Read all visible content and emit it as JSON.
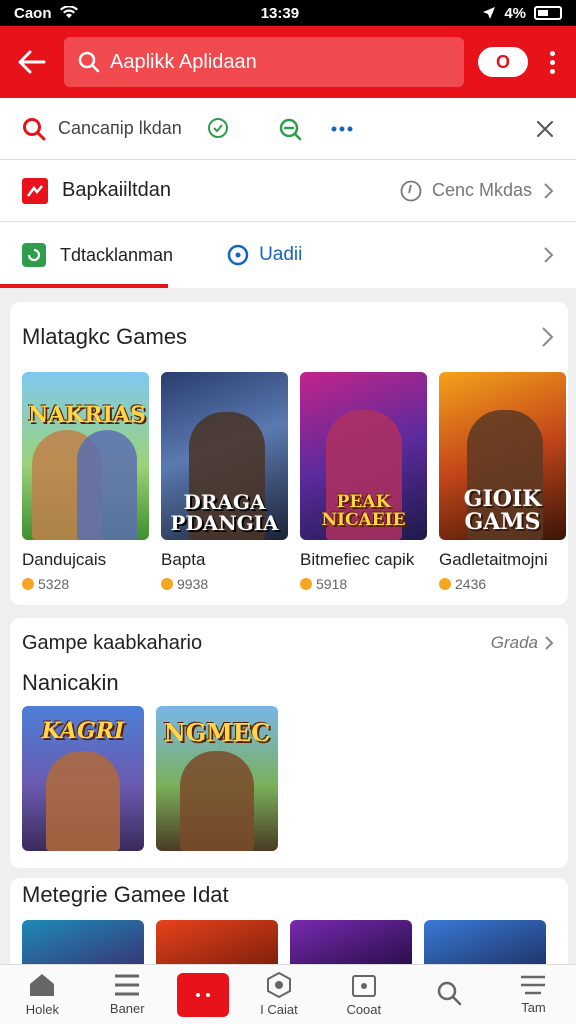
{
  "status": {
    "carrier": "Caon",
    "time": "13:39",
    "battery": "4%"
  },
  "appbar": {
    "search_text": "Aaplikk Aplidaan",
    "pill_label": "O"
  },
  "filter": {
    "label": "Cancaпip lkdan"
  },
  "category_row_1": {
    "title": "Bapkaiiltdan",
    "right_label": "Cenc Mkdas"
  },
  "category_row_2": {
    "title": "Tdtacklanman",
    "right_label": "Uadii"
  },
  "section_1": {
    "title": "Mlatagkc Games",
    "games": [
      {
        "art": "NAKRIAS",
        "name": "Dandujcais",
        "rating": "5328"
      },
      {
        "art": "DRAGA PDANGIA",
        "name": "Bapta",
        "rating": "9938"
      },
      {
        "art": "PEAK NICAEIE",
        "name": "Bitmefiec capik",
        "rating": "5918"
      },
      {
        "art": "GIOIK GAMS",
        "name": "Gadletaitmojni",
        "rating": "2436"
      }
    ]
  },
  "section_2": {
    "title": "Gampe kaabkahario",
    "action": "Grada",
    "subtitle": "Nanicakin",
    "games": [
      {
        "art": "KAGRI"
      },
      {
        "art": "NGMEC"
      }
    ]
  },
  "section_3": {
    "title": "Metegrie Gamee Idat"
  },
  "bottom_nav": [
    {
      "label": "Holek"
    },
    {
      "label": "Baner"
    },
    {
      "label": ""
    },
    {
      "label": "I Caiat"
    },
    {
      "label": "Cooat"
    },
    {
      "label": ""
    },
    {
      "label": "Tam"
    }
  ],
  "colors": {
    "brand": "#e8121b",
    "link": "#1565c0",
    "star": "#f5a623"
  }
}
